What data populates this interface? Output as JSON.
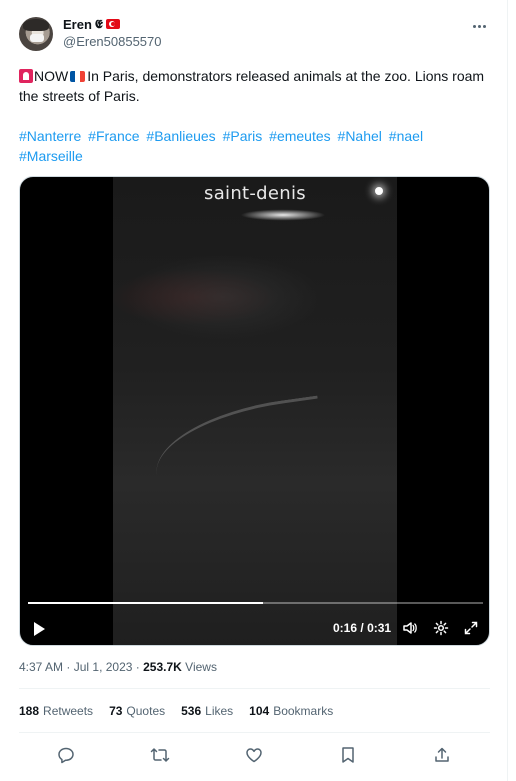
{
  "author": {
    "display_name": "Eren",
    "handle": "@Eren50855570",
    "badge_icon": "eagle-badge-icon",
    "flag_icon": "turkey-flag-icon",
    "badge_glyph": "𝕰"
  },
  "tweet": {
    "prefix_icon": "police-light-icon",
    "now_label": "NOW",
    "flag_icon": "france-flag-icon",
    "body": "In Paris, demonstrators released animals at the zoo. Lions roam the streets of Paris.",
    "hashtags": [
      "#Nanterre",
      "#France",
      "#Banlieues",
      "#Paris",
      "#emeutes",
      "#Nahel",
      "#nael",
      "#Marseille"
    ]
  },
  "video": {
    "overlay_text": "saint-denis",
    "current_time": "0:16",
    "separator": "/",
    "duration": "0:31",
    "progress_fraction": 0.516
  },
  "meta": {
    "time": "4:37 AM",
    "dot": "·",
    "date": "Jul 1, 2023",
    "views_count": "253.7K",
    "views_label": "Views"
  },
  "stats": [
    {
      "count": "188",
      "label": "Retweets"
    },
    {
      "count": "73",
      "label": "Quotes"
    },
    {
      "count": "536",
      "label": "Likes"
    },
    {
      "count": "104",
      "label": "Bookmarks"
    }
  ],
  "actions": [
    "reply-icon",
    "retweet-icon",
    "like-icon",
    "bookmark-icon",
    "share-icon"
  ],
  "colors": {
    "link": "#1d9bf0",
    "text": "#0f1419",
    "secondary": "#536471",
    "border": "#eff3f4"
  }
}
